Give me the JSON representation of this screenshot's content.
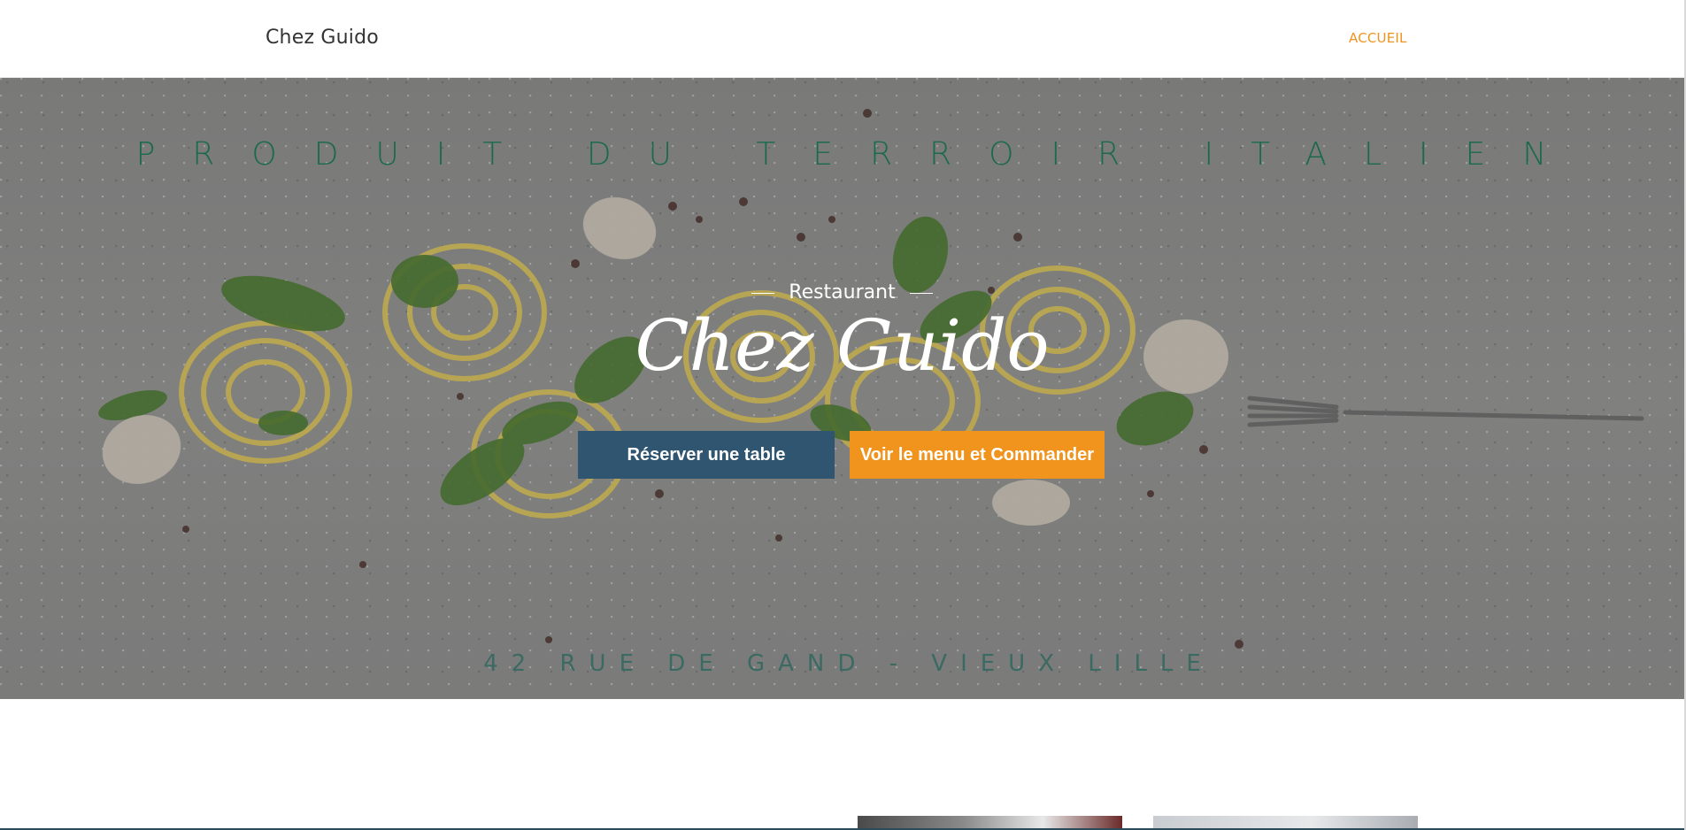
{
  "navbar": {
    "brand": "Chez Guido",
    "links": [
      {
        "label": "ACCUEIL"
      }
    ]
  },
  "hero": {
    "banner_top": "PRODUIT DU TERROIR ITALIEN",
    "eyebrow": "Restaurant",
    "title": "Chez Guido",
    "banner_bottom": "42 RUE DE GAND - VIEUX LILLE",
    "buttons": {
      "reserve_label": "Réserver une table",
      "menu_label": "Voir le menu et Commander"
    }
  },
  "colors": {
    "accent": "#f0941e",
    "primary_button": "#2f5570",
    "banner_text": "#1b6a4a"
  },
  "icons": [
    "pasta-nest-illustration",
    "basil-leaf-illustration",
    "mushroom-illustration",
    "fork-illustration"
  ]
}
